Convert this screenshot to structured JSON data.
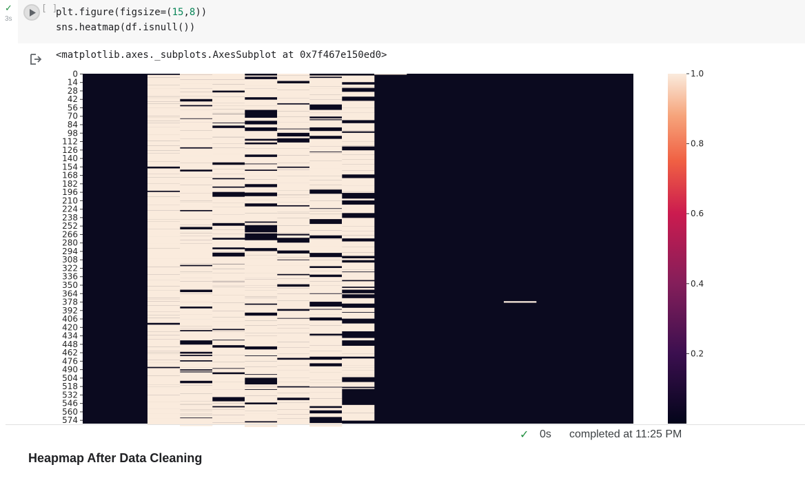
{
  "cell": {
    "exec_check": "✓",
    "exec_time": "3s",
    "bracket": "[ ]",
    "code_line1_a": "plt.figure(figsize=(",
    "code_line1_n1": "15",
    "code_line1_b": ",",
    "code_line1_n2": "8",
    "code_line1_c": "))",
    "code_line2": "sns.heatmap(df.isnull())"
  },
  "output": {
    "repr_text": "<matplotlib.axes._subplots.AxesSubplot at 0x7f467e150ed0>"
  },
  "chart_data": {
    "type": "heatmap",
    "title": "",
    "xlabel": "",
    "ylabel": "",
    "y_tick_labels": [
      "0",
      "14",
      "28",
      "42",
      "56",
      "70",
      "84",
      "98",
      "112",
      "126",
      "140",
      "154",
      "168",
      "182",
      "196",
      "210",
      "224",
      "238",
      "252",
      "266",
      "280",
      "294",
      "308",
      "322",
      "336",
      "350",
      "364",
      "378",
      "392",
      "406",
      "420",
      "434",
      "448",
      "462",
      "476",
      "490",
      "504",
      "518",
      "532",
      "546",
      "560",
      "574"
    ],
    "x_tick_labels": [],
    "colormap": "rocket",
    "colorbar": {
      "ticks": [
        0.2,
        0.4,
        0.6,
        0.8,
        1.0
      ],
      "tick_labels": [
        "0.2",
        "0.4",
        "0.6",
        "0.8",
        "1.0"
      ],
      "range": [
        0,
        1
      ]
    },
    "value_meaning": "1 = missing (light), 0 = present (dark)",
    "rows": 580,
    "columns": [
      {
        "index": 0,
        "missing_fraction": 0.0
      },
      {
        "index": 1,
        "missing_fraction": 0.06
      },
      {
        "index": 2,
        "missing_fraction": 0.82
      },
      {
        "index": 3,
        "missing_fraction": 0.78
      },
      {
        "index": 4,
        "missing_fraction": 0.72
      },
      {
        "index": 5,
        "missing_fraction": 0.55
      },
      {
        "index": 6,
        "missing_fraction": 0.72
      },
      {
        "index": 7,
        "missing_fraction": 0.58
      },
      {
        "index": 8,
        "missing_fraction": 0.5
      },
      {
        "index": 9,
        "missing_fraction": 0.01
      },
      {
        "index": 10,
        "missing_fraction": 0.01
      },
      {
        "index": 11,
        "missing_fraction": 0.04
      },
      {
        "index": 12,
        "missing_fraction": 0.04
      },
      {
        "index": 13,
        "missing_fraction": 0.04
      },
      {
        "index": 14,
        "missing_fraction": 0.04
      },
      {
        "index": 15,
        "missing_fraction": 0.0
      },
      {
        "index": 16,
        "missing_fraction": 0.0
      }
    ],
    "colors": {
      "dark": "#0b0a1f",
      "light": "#faebdd"
    }
  },
  "status": {
    "check": "✓",
    "duration": "0s",
    "completed": "completed at 11:25 PM"
  },
  "heading": "Heapmap After Data Cleaning",
  "colors": {
    "cell_bg": "#f7f7f7",
    "success": "#1e8e3e"
  }
}
